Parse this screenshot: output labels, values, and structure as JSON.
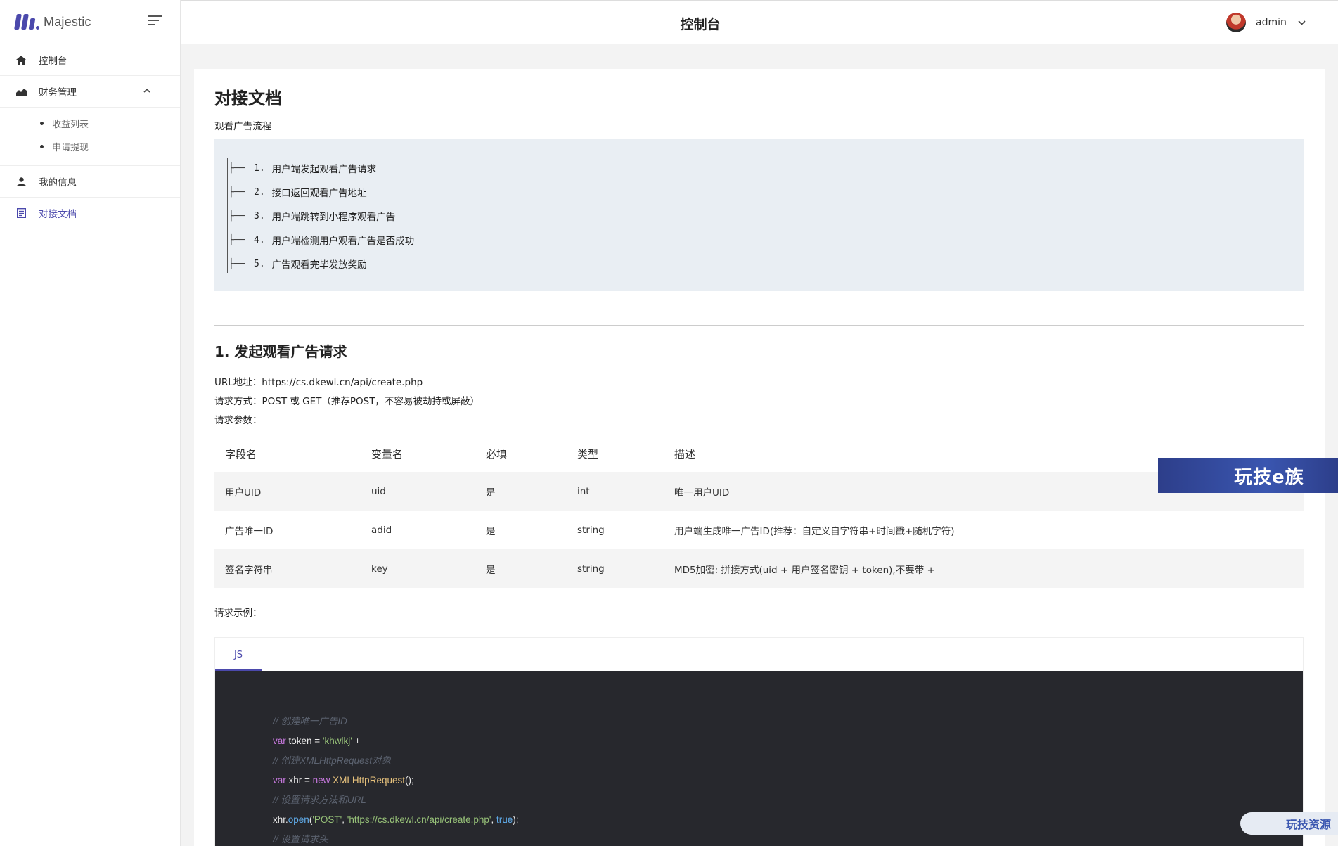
{
  "brand": {
    "name": "Majestic"
  },
  "header": {
    "title": "控制台",
    "user": "admin"
  },
  "sidebar": {
    "items": [
      {
        "label": "控制台",
        "icon": "home-icon"
      },
      {
        "label": "财务管理",
        "icon": "chart-area-icon",
        "children": [
          "收益列表",
          "申请提现"
        ]
      },
      {
        "label": "我的信息",
        "icon": "user-icon"
      },
      {
        "label": "对接文档",
        "icon": "document-icon",
        "active": true
      }
    ]
  },
  "doc": {
    "title": "对接文档",
    "flow_title": "观看广告流程",
    "flow": [
      {
        "num": "1.",
        "text": "用户端发起观看广告请求"
      },
      {
        "num": "2.",
        "text": "接口返回观看广告地址"
      },
      {
        "num": "3.",
        "text": "用户端跳转到小程序观看广告"
      },
      {
        "num": "4.",
        "text": "用户端检测用户观看广告是否成功"
      },
      {
        "num": "5.",
        "text": "广告观看完毕发放奖励"
      }
    ],
    "section_title": "1. 发起观看广告请求",
    "url_line": "URL地址：https://cs.dkewl.cn/api/create.php",
    "method_line": "请求方式：POST 或 GET（推荐POST，不容易被劫持或屏蔽）",
    "params_label": "请求参数：",
    "table": {
      "headers": [
        "字段名",
        "变量名",
        "必填",
        "类型",
        "描述"
      ],
      "rows": [
        [
          "用户UID",
          "uid",
          "是",
          "int",
          "唯一用户UID"
        ],
        [
          "广告唯一ID",
          "adid",
          "是",
          "string",
          "用户端生成唯一广告ID(推荐：自定义自字符串+时间戳+随机字符)"
        ],
        [
          "签名字符串",
          "key",
          "是",
          "string",
          "MD5加密: 拼接方式(uid + 用户签名密钥 + token),不要带 +"
        ]
      ]
    },
    "example_label": "请求示例：",
    "code_tab": "JS",
    "code": {
      "c1": "// 创建唯一广告ID",
      "l2_kw": "var",
      "l2_a": " token = ",
      "l2_str": "'khwlkj'",
      "l2_b": " +",
      "c3": "// 创建XMLHttpRequest对象",
      "l4_kw": "var",
      "l4_a": " xhr = ",
      "l4_new": "new",
      "l4_cls": " XMLHttpRequest",
      "l4_b": "();",
      "c5": "// 设置请求方法和URL",
      "l6_a": "xhr.",
      "l6_fn": "open",
      "l6_b": "(",
      "l6_s1": "'POST'",
      "l6_c": ", ",
      "l6_s2": "'https://cs.dkewl.cn/api/create.php'",
      "l6_d": ", ",
      "l6_bool": "true",
      "l6_e": ");",
      "c7": "// 设置请求头"
    }
  },
  "watermark": {
    "banner": "玩技e族",
    "pill": "玩技资源"
  }
}
